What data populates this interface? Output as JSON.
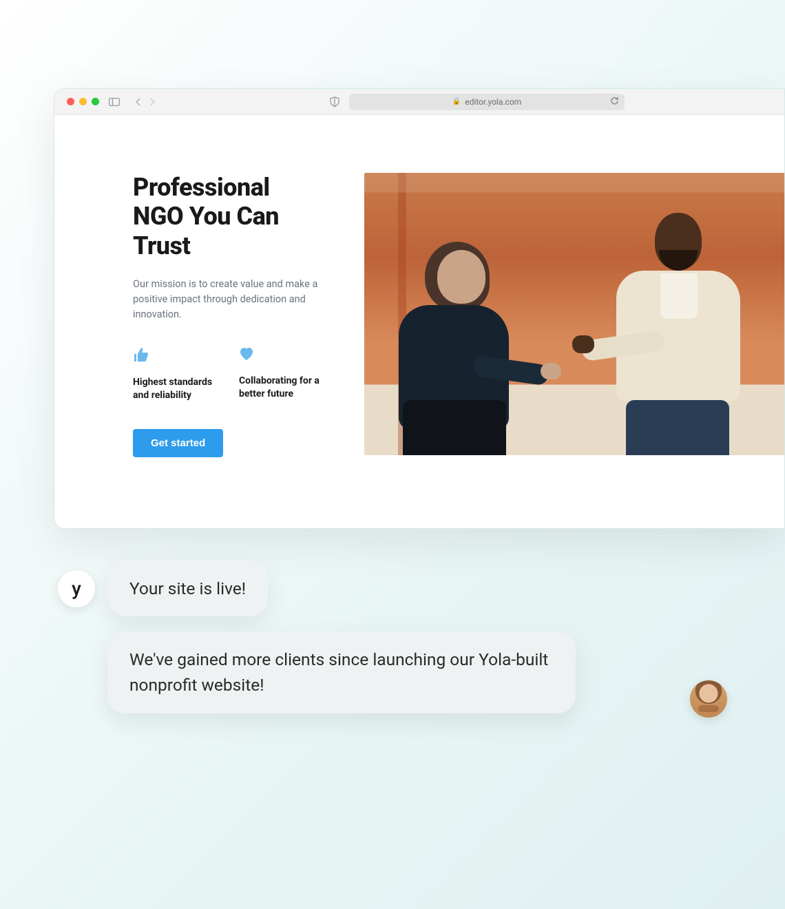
{
  "browser": {
    "url": "editor.yola.com"
  },
  "site": {
    "heading": "Professional NGO You Can Trust",
    "subheading": "Our mission is to create value and make a positive impact through dedication and innovation.",
    "features": [
      {
        "icon": "thumbs-up-icon",
        "text": "Highest standards and reliability"
      },
      {
        "icon": "heart-icon",
        "text": "Collaborating for a better future"
      }
    ],
    "cta_label": "Get started",
    "hero_image_alt": "Two people shaking hands in a modern office"
  },
  "chat": {
    "assistant_avatar_letter": "y",
    "message_assistant": "Your site is live!",
    "message_user": "We've gained more clients since launching our Yola-built nonprofit website!"
  },
  "colors": {
    "accent": "#2e9cec",
    "feature_icon": "#5eb3f0"
  }
}
